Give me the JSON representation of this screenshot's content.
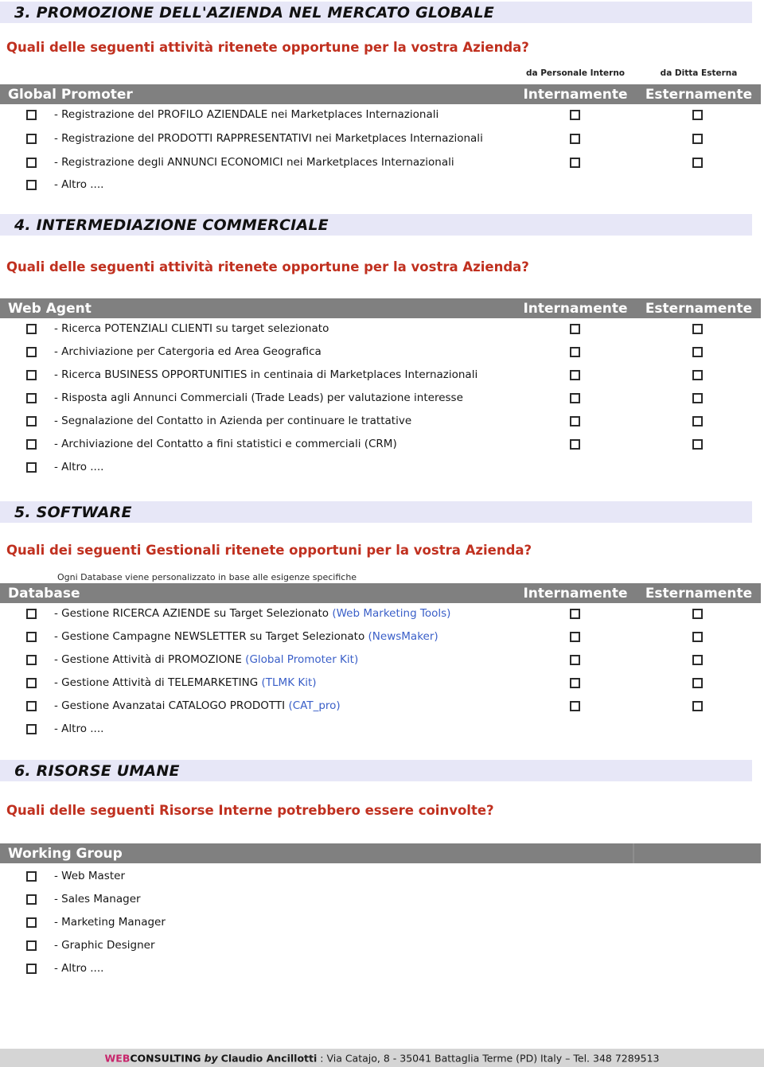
{
  "colors": {
    "section_band": "#e7e7f7",
    "question_red": "#c0301f",
    "table_bar_gray": "#808080",
    "link_blue": "#3a5fc8",
    "footer_band": "#d5d5d5",
    "brand_magenta": "#c7256b"
  },
  "column_annotations": {
    "internal": "da Personale Interno",
    "external": "da Ditta Esterna"
  },
  "column_headers": {
    "internamente": "Internamente",
    "esternamente": "Esternamente"
  },
  "sections": [
    {
      "id": "promozione",
      "title": "3. PROMOZIONE DELL'AZIENDA NEL MERCATO GLOBALE",
      "question": "Quali delle seguenti attività ritenete opportune per la vostra Azienda?",
      "table_label": "Global Promoter",
      "show_column_annotations": true,
      "show_column_headers": true,
      "note": "",
      "rows": [
        {
          "label": "- Registrazione del PROFILO AZIENDALE nei Marketplaces Internazionali",
          "accent": "",
          "tail": "",
          "checks": true
        },
        {
          "label": "- Registrazione del PRODOTTI RAPPRESENTATIVI nei Marketplaces Internazionali",
          "accent": "",
          "tail": "",
          "checks": true
        },
        {
          "label": "- Registrazione degli ANNUNCI ECONOMICI nei Marketplaces Internazionali",
          "accent": "",
          "tail": "",
          "checks": true
        },
        {
          "label": "- Altro ....",
          "accent": "",
          "tail": "",
          "checks": false
        }
      ]
    },
    {
      "id": "intermediazione",
      "title": "4. INTERMEDIAZIONE COMMERCIALE",
      "question": "Quali delle seguenti attività ritenete opportune per la vostra Azienda?",
      "table_label": "Web Agent",
      "show_column_annotations": false,
      "show_column_headers": true,
      "note": "",
      "rows": [
        {
          "label": "- Ricerca POTENZIALI CLIENTI su target selezionato",
          "accent": "",
          "tail": "",
          "checks": true
        },
        {
          "label": "- Archiviazione per Catergoria ed Area Geografica",
          "accent": "",
          "tail": "",
          "checks": true
        },
        {
          "label": "- Ricerca BUSINESS OPPORTUNITIES in centinaia di Marketplaces Internazionali",
          "accent": "",
          "tail": "",
          "checks": true
        },
        {
          "label": "- Risposta agli Annunci Commerciali (Trade Leads) per valutazione interesse",
          "accent": "",
          "tail": "",
          "checks": true
        },
        {
          "label": "- Segnalazione del Contatto in Azienda per continuare le trattative",
          "accent": "",
          "tail": "",
          "checks": true
        },
        {
          "label": "- Archiviazione del Contatto a fini statistici e commerciali (CRM)",
          "accent": "",
          "tail": "",
          "checks": true
        },
        {
          "label": "- Altro ....",
          "accent": "",
          "tail": "",
          "checks": false
        }
      ]
    },
    {
      "id": "software",
      "title": "5. SOFTWARE",
      "question": "Quali dei seguenti Gestionali ritenete opportuni per la vostra Azienda?",
      "table_label": "Database",
      "show_column_annotations": false,
      "show_column_headers": true,
      "note": "Ogni Database viene personalizzato in base alle esigenze specifiche",
      "rows": [
        {
          "label": "- Gestione RICERCA AZIENDE su Target Selezionato ",
          "accent": "(Web Marketing Tools)",
          "tail": "",
          "checks": true
        },
        {
          "label": "- Gestione Campagne NEWSLETTER su Target Selezionato ",
          "accent": "(NewsMaker)",
          "tail": "",
          "checks": true
        },
        {
          "label": "- Gestione Attività di PROMOZIONE ",
          "accent": "(Global Promoter Kit)",
          "tail": "",
          "checks": true
        },
        {
          "label": "- Gestione Attività di TELEMARKETING ",
          "accent": "(TLMK Kit)",
          "tail": "",
          "checks": true
        },
        {
          "label": "- Gestione Avanzatai CATALOGO PRODOTTI ",
          "accent": "(CAT_pro)",
          "tail": "",
          "checks": true
        },
        {
          "label": "- Altro ....",
          "accent": "",
          "tail": "",
          "checks": false
        }
      ]
    },
    {
      "id": "risorse-umane",
      "title": "6. RISORSE UMANE",
      "question": "Quali delle seguenti Risorse Interne potrebbero essere coinvolte?",
      "table_label": "Working Group",
      "show_column_annotations": false,
      "show_column_headers": false,
      "note": "",
      "rows": [
        {
          "label": "- Web Master",
          "accent": "",
          "tail": "",
          "checks": false
        },
        {
          "label": "- Sales Manager",
          "accent": "",
          "tail": "",
          "checks": false
        },
        {
          "label": "- Marketing Manager",
          "accent": "",
          "tail": "",
          "checks": false
        },
        {
          "label": "- Graphic Designer",
          "accent": "",
          "tail": "",
          "checks": false
        },
        {
          "label": "- Altro ....",
          "accent": "",
          "tail": "",
          "checks": false
        }
      ]
    }
  ],
  "footer": {
    "brand_web": "WEB",
    "brand_consulting": "CONSULTING",
    "by": "by",
    "person": "Claudio Ancillotti",
    "address": ": Via Catajo, 8 - 35041 Battaglia Terme (PD) Italy – Tel. 348 7289513"
  }
}
